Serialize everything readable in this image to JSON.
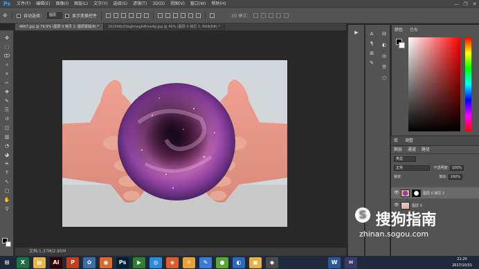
{
  "app": {
    "logo": "Ps"
  },
  "menu": [
    "文件(F)",
    "编辑(E)",
    "图像(I)",
    "图层(L)",
    "文字(Y)",
    "选择(S)",
    "滤镜(T)",
    "3D(D)",
    "视图(V)",
    "窗口(W)",
    "帮助(H)"
  ],
  "window_controls": [
    "—",
    "❐",
    "✕"
  ],
  "options": {
    "auto_select_label": "自动选择：",
    "auto_select_value": "图层",
    "show_transform_label": "显示变换控件",
    "mode_3d_label": "3D 模式："
  },
  "tabs": [
    {
      "label": "4867.jpg @ 79.9% (图层 0 拷贝 2, 图层蒙版/8) *",
      "active": true
    },
    {
      "label": "162548z33eghnwgb4thw4g.jpg @ 40% (图层 0 拷贝 2, RGB/8#) *",
      "active": false
    }
  ],
  "status": {
    "doc": "文档:1.37M/2.95M"
  },
  "color_panel": {
    "tabs": [
      "颜色",
      "色板"
    ]
  },
  "library_panel": {
    "tabs": [
      "库",
      "调整"
    ]
  },
  "layers_panel": {
    "tabs": [
      "图层",
      "通道",
      "路径"
    ],
    "filter": "类型",
    "blend_mode": "正常",
    "opacity_label": "不透明度:",
    "opacity": "100%",
    "lock_label": "锁定:",
    "fill_label": "填充:",
    "fill": "100%",
    "layers": [
      {
        "name": "图层 0 拷贝 2",
        "selected": true
      },
      {
        "name": "图层 0",
        "selected": false
      }
    ]
  },
  "tools": [
    "move-tool-icon",
    "marquee-tool-icon",
    "lasso-tool-icon",
    "quick-select-tool-icon",
    "crop-tool-icon",
    "eyedropper-tool-icon",
    "healing-brush-icon",
    "brush-tool-icon",
    "clone-stamp-icon",
    "history-brush-icon",
    "eraser-tool-icon",
    "gradient-tool-icon",
    "blur-tool-icon",
    "dodge-tool-icon",
    "pen-tool-icon",
    "type-tool-icon",
    "path-select-icon",
    "shape-tool-icon",
    "hand-tool-icon",
    "zoom-tool-icon"
  ],
  "taskbar": {
    "apps": [
      {
        "name": "excel-icon",
        "glyph": "X",
        "bg": "#1e7145"
      },
      {
        "name": "folder-icon",
        "glyph": "▤",
        "bg": "#e8b84b"
      },
      {
        "name": "illustrator-icon",
        "glyph": "Ai",
        "bg": "#330000"
      },
      {
        "name": "powerpoint-icon",
        "glyph": "P",
        "bg": "#c43e1c"
      },
      {
        "name": "app-icon-1",
        "glyph": "✿",
        "bg": "#3b6ea5"
      },
      {
        "name": "app-icon-2",
        "glyph": "◉",
        "bg": "#d86a2b"
      },
      {
        "name": "photoshop-icon",
        "glyph": "Ps",
        "bg": "#001e36"
      },
      {
        "name": "media-player-icon",
        "glyph": "▶",
        "bg": "#2d7f2d"
      },
      {
        "name": "browser-icon",
        "glyph": "◎",
        "bg": "#2a8bd8"
      },
      {
        "name": "app-icon-3",
        "glyph": "◈",
        "bg": "#e05a2a"
      },
      {
        "name": "app-icon-4",
        "glyph": "☼",
        "bg": "#e8a23a"
      },
      {
        "name": "app-icon-5",
        "glyph": "✎",
        "bg": "#3a7bd5"
      },
      {
        "name": "app-icon-6",
        "glyph": "●",
        "bg": "#5aa832"
      },
      {
        "name": "app-icon-7",
        "glyph": "◐",
        "bg": "#2c6ac2"
      },
      {
        "name": "app-icon-8",
        "glyph": "▣",
        "bg": "#e6b04a"
      },
      {
        "name": "app-icon-9",
        "glyph": "◆",
        "bg": "#4a4a4a"
      },
      {
        "name": "word-icon",
        "glyph": "W",
        "bg": "#2b579a"
      },
      {
        "name": "app-icon-10",
        "glyph": "✉",
        "bg": "#3a3a6a"
      }
    ],
    "time": "21:20",
    "date": "2017/10/31"
  },
  "watermark": {
    "logo": "搜狗指南",
    "url": "zhinan.sogou.com"
  }
}
